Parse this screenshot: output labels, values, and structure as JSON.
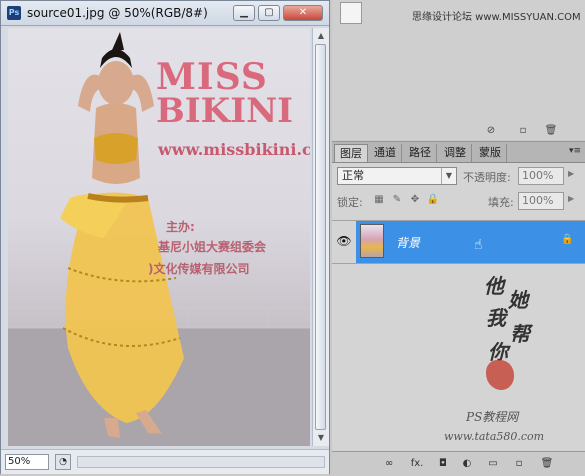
{
  "document": {
    "app_badge": "Ps",
    "title": "source01.jpg @ 50%(RGB/8#)",
    "minimize": "▁",
    "maximize": "▢",
    "close": "✕",
    "zoom": "50%",
    "status_button": "◔"
  },
  "canvas": {
    "logo_line1": "MISS",
    "logo_line2": "BIKINI",
    "url": "www.missbikini.cc",
    "banner_line1": "主办:",
    "banner_line2": "基尼小姐大赛组委会",
    "banner_line3": ")文化传媒有限公司"
  },
  "top_watermark": "思缘设计论坛 www.MISSYUAN.COM",
  "layers_panel": {
    "tabs": [
      "图层",
      "通道",
      "路径",
      "调整",
      "蒙版"
    ],
    "menu_icon": "▾≡",
    "blend_mode": "正常",
    "opacity_label": "不透明度:",
    "opacity_value": "100%",
    "lock_label": "锁定:",
    "fill_label": "填充:",
    "fill_value": "100%",
    "layer": {
      "name": "背景",
      "visible_icon": "eye-icon",
      "locked_icon": "lock-icon"
    },
    "bottom_icons": [
      "link-icon",
      "fx-icon",
      "mask-icon",
      "adjustment-icon",
      "folder-icon",
      "new-layer-icon",
      "trash-icon"
    ],
    "fx_label": "fx."
  },
  "signature": {
    "chars": [
      "他",
      "她",
      "我",
      "帮",
      "你"
    ],
    "site_name": "PS教程网",
    "site_url": "www.tata580.com"
  }
}
